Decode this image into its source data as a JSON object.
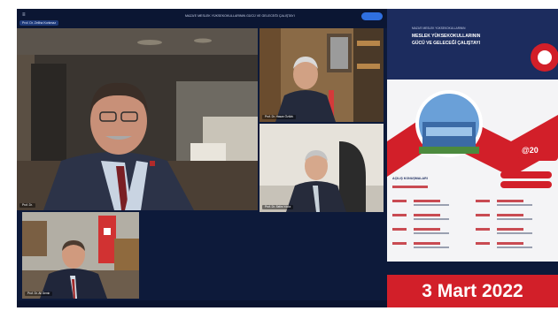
{
  "meeting": {
    "title": "MAZA'E MESLEK YÜKSEKOKULLARININ GÜCÜ VE GELECEĞİ ÇALIŞTAYI",
    "presenter_tag": "Prof. Dr. Zeliha Korkmaz",
    "participants": [
      {
        "label": "Prof. Dr."
      },
      {
        "label": "Prof. Dr. Hasan Öztürk"
      },
      {
        "label": "Prof. Dr. Selim Yıldız"
      },
      {
        "label": "Prof. Dr. Ali Demir"
      }
    ]
  },
  "poster": {
    "header_small": "MAZA'E MESLEK YÜKSEKOKULLARININ",
    "title_line1": "MESLEK YÜKSEKOKULLARININ",
    "title_line2": "GÜCÜ VE GELECEĞİ ÇALIŞTAYI",
    "section_label": "AÇILIŞ KONUŞMALARI",
    "year_partial": "@20"
  },
  "date_banner": "3 Mart 2022",
  "colors": {
    "accent": "#d21f29",
    "call_bg": "#0d1a3a",
    "pill": "#2f6fe0"
  }
}
